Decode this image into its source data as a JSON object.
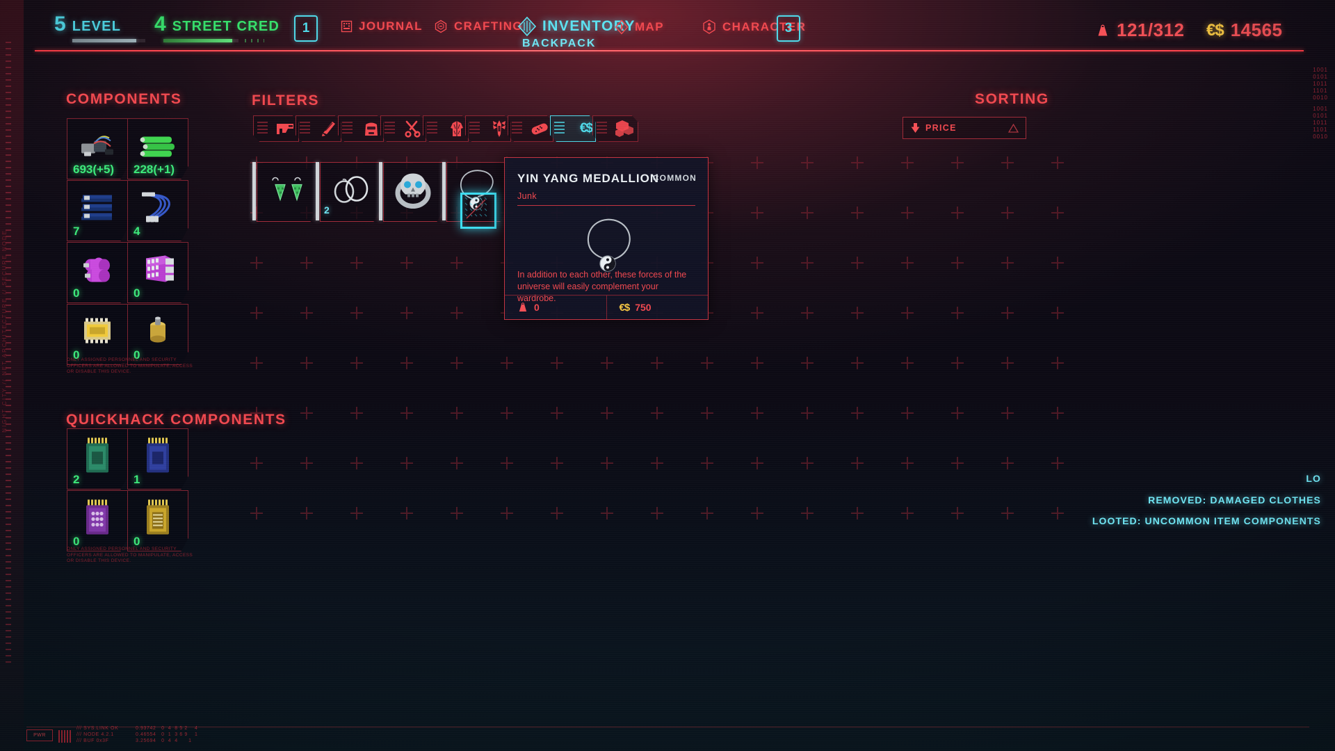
{
  "header": {
    "level": {
      "value": "5",
      "label": "LEVEL"
    },
    "street_cred": {
      "value": "4",
      "label": "STREET CRED"
    },
    "key_left": "1",
    "key_right": "3",
    "nav": [
      {
        "label": "JOURNAL",
        "icon": "journal-icon",
        "active": false
      },
      {
        "label": "CRAFTING",
        "icon": "crafting-icon",
        "active": false
      },
      {
        "label": "INVENTORY",
        "icon": "inventory-icon",
        "active": true
      },
      {
        "label": "MAP",
        "icon": "map-icon",
        "active": false
      },
      {
        "label": "CHARACTER",
        "icon": "character-icon",
        "active": false
      }
    ],
    "subtitle": "BACKPACK",
    "carry_weight": "121/312",
    "money": "14565",
    "currency_symbol": "€$"
  },
  "components": {
    "title": "COMPONENTS",
    "items": [
      {
        "qty": "693(+5)",
        "icon": "common-components-icon"
      },
      {
        "qty": "228(+1)",
        "icon": "uncommon-components-icon"
      },
      {
        "qty": "7",
        "icon": "rare-components-icon"
      },
      {
        "qty": "4",
        "icon": "rare-cables-icon"
      },
      {
        "qty": "0",
        "icon": "epic-components-icon"
      },
      {
        "qty": "0",
        "icon": "epic-module-icon"
      },
      {
        "qty": "0",
        "icon": "legendary-chip-icon"
      },
      {
        "qty": "0",
        "icon": "legendary-component-icon"
      }
    ],
    "note": "ONLY ASSIGNED PERSONNEL AND SECURITY OFFICERS ARE ALLOWED TO MANIPULATE, ACCESS OR DISABLE THIS DEVICE."
  },
  "quickhack": {
    "title": "QUICKHACK COMPONENTS",
    "items": [
      {
        "qty": "2",
        "icon": "green-quickhack-icon"
      },
      {
        "qty": "1",
        "icon": "blue-quickhack-icon"
      },
      {
        "qty": "0",
        "icon": "purple-quickhack-icon"
      },
      {
        "qty": "0",
        "icon": "gold-quickhack-icon"
      }
    ],
    "note": "ONLY ASSIGNED PERSONNEL AND SECURITY OFFICERS ARE ALLOWED TO MANIPULATE, ACCESS OR DISABLE THIS DEVICE."
  },
  "filters": {
    "title": "FILTERS",
    "buttons": [
      {
        "name": "weapons-filter",
        "icon": "pistol-icon",
        "active": false
      },
      {
        "name": "melee-filter",
        "icon": "blade-icon",
        "active": false
      },
      {
        "name": "backpack-filter",
        "icon": "backpack-icon",
        "active": false
      },
      {
        "name": "tools-filter",
        "icon": "scissors-icon",
        "active": false
      },
      {
        "name": "clothing-filter",
        "icon": "jacket-icon",
        "active": false
      },
      {
        "name": "grenade-filter",
        "icon": "grenade-icon",
        "active": false
      },
      {
        "name": "consumables-filter",
        "icon": "pill-icon",
        "active": false
      },
      {
        "name": "junk-filter",
        "icon": "money-icon",
        "active": true
      },
      {
        "name": "crafting-filter",
        "icon": "crafting-blocks-icon",
        "active": false
      }
    ]
  },
  "sorting": {
    "title": "SORTING",
    "selected": "PRICE",
    "direction": "descending"
  },
  "inventory": {
    "items": [
      {
        "name": "earrings",
        "rarity_color": "#cfd4d8",
        "qty": ""
      },
      {
        "name": "hoop-earrings",
        "rarity_color": "#cfd4d8",
        "qty": "2"
      },
      {
        "name": "skull-ring",
        "rarity_color": "#cfd4d8",
        "qty": ""
      },
      {
        "name": "yin-yang-medallion",
        "rarity_color": "#cfd4d8",
        "qty": "",
        "selected": true
      }
    ]
  },
  "tooltip": {
    "title": "YIN YANG MEDALLION",
    "rarity": "COMMON",
    "type": "Junk",
    "description": "In addition to each other, these forces of the universe will easily complement your wardrobe.",
    "weight": "0",
    "price": "750",
    "currency_symbol": "€$"
  },
  "notifications": [
    "LO",
    "REMOVED: DAMAGED CLOTHES",
    "LOOTED: UNCOMMON ITEM COMPONENTS"
  ],
  "decor": {
    "vertical_text": "NIGHT CITY // NET ARCHITECTURE // SECURE NODE",
    "binary_top": "1001\n0101\n1011\n1101\n0010",
    "binary_mid": "1001\n0101\n1011\n1101\n0010",
    "bottom_chip": "PWR",
    "bottom_numbers": "0.93742   0  4  8 5 2    4\n0.46554   0  1  3 6 9    1\n3.25694   0  4  4      1"
  }
}
